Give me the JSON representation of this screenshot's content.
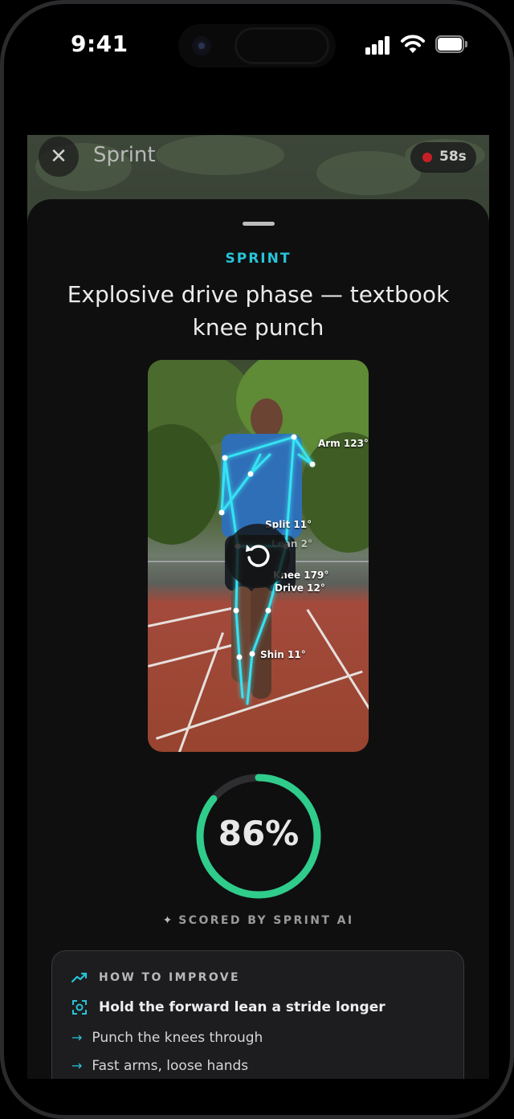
{
  "status_bar": {
    "time": "9:41"
  },
  "top_bar": {
    "title": "Sprint",
    "timer": "58s"
  },
  "sheet": {
    "eyebrow": "SPRINT",
    "headline": "Explosive drive phase — textbook knee punch"
  },
  "pose_labels": {
    "arm": "Arm 123°",
    "split": "Split 11°",
    "lean": "Lean 2°",
    "knee": "Knee 179°",
    "drive": "Drive 12°",
    "shin": "Shin 11°"
  },
  "score": {
    "value": "86%",
    "fraction": 0.86,
    "caption": "SCORED BY SPRINT AI"
  },
  "improve": {
    "heading": "HOW TO IMPROVE",
    "main_tip": "Hold the forward lean a stride longer",
    "tips": [
      "Punch the knees through",
      "Fast arms, loose hands"
    ]
  },
  "colors": {
    "accent": "#27c4d8",
    "score_ring": "#2fcc8b",
    "recording": "#c81f27"
  }
}
